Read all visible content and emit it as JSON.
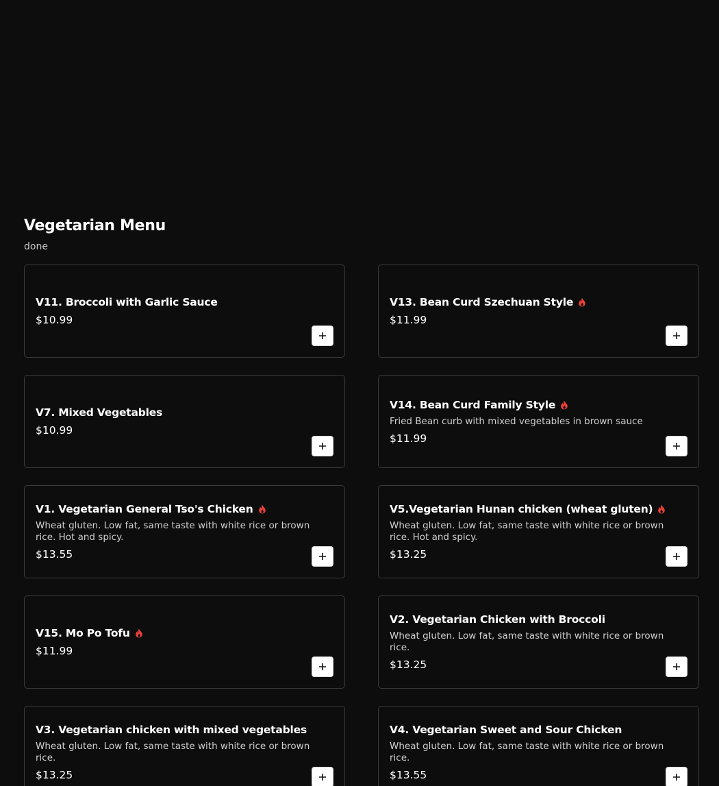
{
  "section": {
    "title": "Vegetarian Menu",
    "subtitle": "done"
  },
  "colors": {
    "background": "#0d0d0d",
    "card_border": "#3a3a3a",
    "spicy": "#e8403a",
    "button_bg": "#ffffff"
  },
  "icons": {
    "spicy": "flame-icon",
    "add": "plus-icon"
  },
  "items": [
    {
      "name": "V11. Broccoli with Garlic Sauce",
      "description": "",
      "price": "$10.99",
      "spicy": false
    },
    {
      "name": "V13. Bean Curd Szechuan Style",
      "description": "",
      "price": "$11.99",
      "spicy": true
    },
    {
      "name": "V7. Mixed Vegetables",
      "description": "",
      "price": "$10.99",
      "spicy": false
    },
    {
      "name": "V14. Bean Curd Family Style",
      "description": "Fried Bean curb with mixed vegetables in brown sauce",
      "price": "$11.99",
      "spicy": true
    },
    {
      "name": "V1. Vegetarian General Tso's Chicken",
      "description": "Wheat gluten. Low fat, same taste with white rice or brown rice. Hot and spicy.",
      "price": "$13.55",
      "spicy": true
    },
    {
      "name": "V5.Vegetarian Hunan chicken (wheat gluten)",
      "description": "Wheat gluten. Low fat, same taste with white rice or brown rice. Hot and spicy.",
      "price": "$13.25",
      "spicy": true
    },
    {
      "name": "V15. Mo Po Tofu",
      "description": "",
      "price": "$11.99",
      "spicy": true
    },
    {
      "name": "V2. Vegetarian Chicken with Broccoli",
      "description": "Wheat gluten. Low fat, same taste with white rice or brown rice.",
      "price": "$13.25",
      "spicy": false
    },
    {
      "name": "V3. Vegetarian chicken with mixed vegetables",
      "description": "Wheat gluten. Low fat, same taste with white rice or brown rice.",
      "price": "$13.25",
      "spicy": false
    },
    {
      "name": "V4. Vegetarian Sweet and Sour Chicken",
      "description": "Wheat gluten. Low fat, same taste with white rice or brown rice.",
      "price": "$13.55",
      "spicy": false
    }
  ]
}
